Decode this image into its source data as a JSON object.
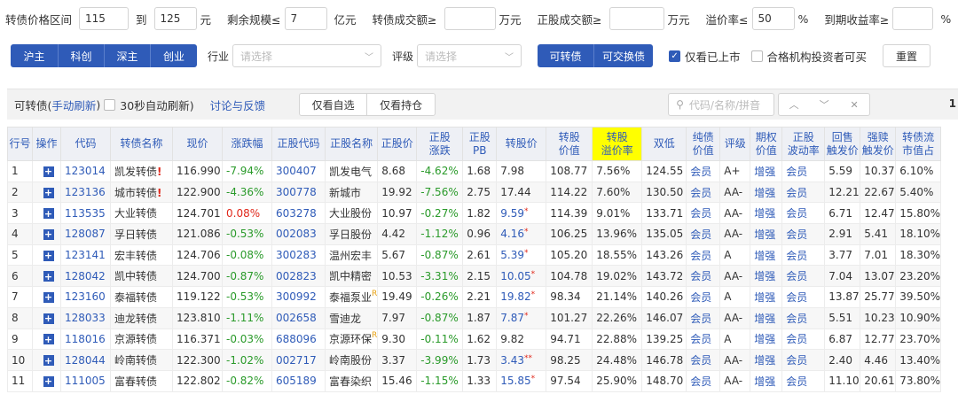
{
  "filters": {
    "price_range_label": "转债价格区间",
    "price_min": "115",
    "to_label": "到",
    "price_max": "125",
    "yuan_label": "元",
    "remaining_scale_label": "剩余规模≤",
    "remaining_scale": "7",
    "yiyuan_label": "亿元",
    "bond_turnover_label": "转债成交额≥",
    "bond_turnover": "",
    "wanyuan_label": "万元",
    "stock_turnover_label": "正股成交额≥",
    "stock_turnover": "",
    "wanyuan_label2": "万元",
    "premium_label": "溢价率≤",
    "premium": "50",
    "percent_label": "%",
    "ytm_label": "到期收益率≥",
    "ytm": "",
    "percent_label2": "%"
  },
  "market_buttons": [
    "沪主",
    "科创",
    "深主",
    "创业"
  ],
  "industry": {
    "label": "行业",
    "placeholder": "请选择"
  },
  "rating": {
    "label": "评级",
    "placeholder": "请选择"
  },
  "type_buttons": [
    "可转债",
    "可交换债"
  ],
  "listed_only": {
    "label": "仅看已上市",
    "checked": true
  },
  "qualified_only": {
    "label": "合格机构投资者可买",
    "checked": false
  },
  "reset_label": "重置",
  "toolbar": {
    "title": "可转债(",
    "manual_refresh": "手动刷新",
    "title_close": ")",
    "auto_refresh": "30秒自动刷新)",
    "discuss": "讨论与反馈",
    "tab_watchlist": "仅看自选",
    "tab_holdings": "仅看持仓",
    "search_placeholder": "代码/名称/拼音",
    "right_num": "1"
  },
  "headers": [
    "行号",
    "操作",
    "代码",
    "转债名称",
    "现价",
    "涨跌幅",
    "正股代码",
    "正股名称",
    "正股价",
    "正股\n涨跌",
    "正股\nPB",
    "转股价",
    "转股\n价值",
    "转股\n溢价率",
    "双低",
    "纯债\n价值",
    "评级",
    "期权\n价值",
    "正股\n波动率",
    "回售\n触发价",
    "强赎\n触发价",
    "转债流\n市值占"
  ],
  "rows": [
    {
      "n": "1",
      "code": "123014",
      "name": "凯发转债",
      "bang": "!",
      "price": "116.990",
      "chg": "-7.94%",
      "scode": "300407",
      "sname": "凯发电气",
      "sr": "",
      "sprice": "8.68",
      "schg": "-4.62%",
      "pb": "1.68",
      "cv": "7.98",
      "cvmark": "",
      "cval": "108.77",
      "prem": "7.56%",
      "dl": "124.55",
      "bond": "会员",
      "rating": "A+",
      "opt": "增强",
      "vol": "会员",
      "put": "5.59",
      "call": "10.37",
      "ratio": "6.10%"
    },
    {
      "n": "2",
      "code": "123136",
      "name": "城市转债",
      "bang": "!",
      "price": "122.900",
      "chg": "-4.36%",
      "scode": "300778",
      "sname": "新城市",
      "sr": "",
      "sprice": "19.92",
      "schg": "-7.56%",
      "pb": "2.75",
      "cv": "17.44",
      "cvmark": "",
      "cval": "114.22",
      "prem": "7.60%",
      "dl": "130.50",
      "bond": "会员",
      "rating": "AA-",
      "opt": "增强",
      "vol": "会员",
      "put": "12.21",
      "call": "22.67",
      "ratio": "5.40%"
    },
    {
      "n": "3",
      "code": "113535",
      "name": "大业转债",
      "bang": "",
      "price": "124.701",
      "chg": "0.08%",
      "scode": "603278",
      "sname": "大业股份",
      "sr": "",
      "sprice": "10.97",
      "schg": "-0.27%",
      "pb": "1.82",
      "cv": "9.59",
      "cvmark": "*",
      "cval": "114.39",
      "prem": "9.01%",
      "dl": "133.71",
      "bond": "会员",
      "rating": "AA-",
      "opt": "增强",
      "vol": "会员",
      "put": "6.71",
      "call": "12.47",
      "ratio": "15.80%"
    },
    {
      "n": "4",
      "code": "128087",
      "name": "孚日转债",
      "bang": "",
      "price": "121.086",
      "chg": "-0.53%",
      "scode": "002083",
      "sname": "孚日股份",
      "sr": "",
      "sprice": "4.42",
      "schg": "-1.12%",
      "pb": "0.96",
      "cv": "4.16",
      "cvmark": "*",
      "cval": "106.25",
      "prem": "13.96%",
      "dl": "135.05",
      "bond": "会员",
      "rating": "AA-",
      "opt": "增强",
      "vol": "会员",
      "put": "2.91",
      "call": "5.41",
      "ratio": "18.10%"
    },
    {
      "n": "5",
      "code": "123141",
      "name": "宏丰转债",
      "bang": "",
      "price": "124.706",
      "chg": "-0.08%",
      "scode": "300283",
      "sname": "温州宏丰",
      "sr": "",
      "sprice": "5.67",
      "schg": "-0.87%",
      "pb": "2.61",
      "cv": "5.39",
      "cvmark": "*",
      "cval": "105.20",
      "prem": "18.55%",
      "dl": "143.26",
      "bond": "会员",
      "rating": "A",
      "opt": "增强",
      "vol": "会员",
      "put": "3.77",
      "call": "7.01",
      "ratio": "18.30%"
    },
    {
      "n": "6",
      "code": "128042",
      "name": "凯中转债",
      "bang": "",
      "price": "124.700",
      "chg": "-0.87%",
      "scode": "002823",
      "sname": "凯中精密",
      "sr": "",
      "sprice": "10.53",
      "schg": "-3.31%",
      "pb": "2.15",
      "cv": "10.05",
      "cvmark": "*",
      "cval": "104.78",
      "prem": "19.02%",
      "dl": "143.72",
      "bond": "会员",
      "rating": "AA-",
      "opt": "增强",
      "vol": "会员",
      "put": "7.04",
      "call": "13.07",
      "ratio": "23.20%"
    },
    {
      "n": "7",
      "code": "123160",
      "name": "泰福转债",
      "bang": "",
      "price": "119.122",
      "chg": "-0.53%",
      "scode": "300992",
      "sname": "泰福泵业",
      "sr": "R",
      "sprice": "19.49",
      "schg": "-0.26%",
      "pb": "2.21",
      "cv": "19.82",
      "cvmark": "*",
      "cval": "98.34",
      "prem": "21.14%",
      "dl": "140.26",
      "bond": "会员",
      "rating": "A",
      "opt": "增强",
      "vol": "会员",
      "put": "13.87",
      "call": "25.77",
      "ratio": "39.50%"
    },
    {
      "n": "8",
      "code": "128033",
      "name": "迪龙转债",
      "bang": "",
      "price": "123.810",
      "chg": "-1.11%",
      "scode": "002658",
      "sname": "雪迪龙",
      "sr": "",
      "sprice": "7.97",
      "schg": "-0.87%",
      "pb": "1.87",
      "cv": "7.87",
      "cvmark": "*",
      "cval": "101.27",
      "prem": "22.26%",
      "dl": "146.07",
      "bond": "会员",
      "rating": "AA-",
      "opt": "增强",
      "vol": "会员",
      "put": "5.51",
      "call": "10.23",
      "ratio": "10.90%"
    },
    {
      "n": "9",
      "code": "118016",
      "name": "京源转债",
      "bang": "",
      "price": "116.371",
      "chg": "-0.03%",
      "scode": "688096",
      "sname": "京源环保",
      "sr": "R",
      "sprice": "9.30",
      "schg": "-0.11%",
      "pb": "1.62",
      "cv": "9.82",
      "cvmark": "",
      "cval": "94.71",
      "prem": "22.88%",
      "dl": "139.25",
      "bond": "会员",
      "rating": "A",
      "opt": "增强",
      "vol": "会员",
      "put": "6.87",
      "call": "12.77",
      "ratio": "23.70%"
    },
    {
      "n": "10",
      "code": "128044",
      "name": "岭南转债",
      "bang": "",
      "price": "122.300",
      "chg": "-1.02%",
      "scode": "002717",
      "sname": "岭南股份",
      "sr": "",
      "sprice": "3.37",
      "schg": "-3.99%",
      "pb": "1.73",
      "cv": "3.43",
      "cvmark": "**",
      "cval": "98.25",
      "prem": "24.48%",
      "dl": "146.78",
      "bond": "会员",
      "rating": "AA-",
      "opt": "增强",
      "vol": "会员",
      "put": "2.40",
      "call": "4.46",
      "ratio": "13.40%"
    },
    {
      "n": "11",
      "code": "111005",
      "name": "富春转债",
      "bang": "",
      "price": "122.802",
      "chg": "-0.82%",
      "scode": "605189",
      "sname": "富春染织",
      "sr": "",
      "sprice": "15.46",
      "schg": "-1.15%",
      "pb": "1.33",
      "cv": "15.85",
      "cvmark": "*",
      "cval": "97.54",
      "prem": "25.90%",
      "dl": "148.70",
      "bond": "会员",
      "rating": "AA-",
      "opt": "增强",
      "vol": "会员",
      "put": "11.10",
      "call": "20.61",
      "ratio": "73.80%"
    }
  ],
  "colors": {
    "accent": "#2f5bb8",
    "up": "#e0281b",
    "down": "#2a9a2a",
    "highlight": "#ffff00"
  }
}
